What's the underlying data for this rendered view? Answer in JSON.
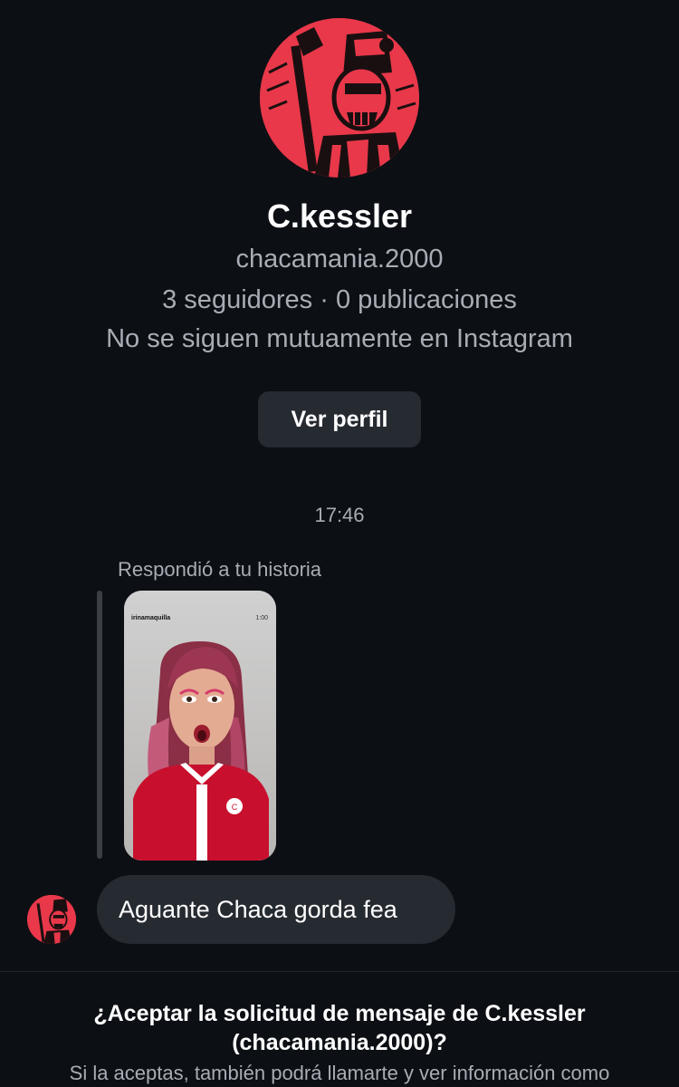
{
  "profile": {
    "name": "C.kessler",
    "username": "chacamania.2000",
    "stats": "3 seguidores · 0 publicaciones",
    "mutual": "No se siguen mutuamente en Instagram",
    "view_profile_label": "Ver perfil"
  },
  "thread": {
    "time": "17:46",
    "replied_label": "Respondió a tu historia",
    "story": {
      "user": "irinamaquilla",
      "time": "1:00"
    },
    "message": "Aguante Chaca gorda fea"
  },
  "request": {
    "title_line1": "¿Aceptar la solicitud de mensaje de C.kessler",
    "title_line2": "(chacamania.2000)?",
    "text": "Si la aceptas, también podrá llamarte y ver información como"
  },
  "colors": {
    "background": "#0c0f14",
    "avatar_red": "#e8384a",
    "bubble": "#262a31",
    "muted_text": "#a8adb5"
  }
}
